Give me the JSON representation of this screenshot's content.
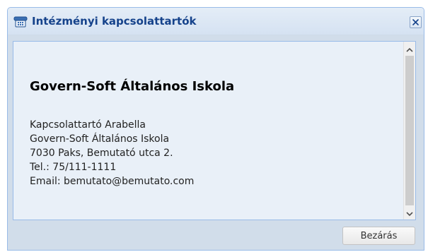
{
  "dialog": {
    "title": "Intézményi kapcsolattartók",
    "title_icon": "telephone-icon",
    "close_icon": "close-icon"
  },
  "contact": {
    "organization": "Govern-Soft Általános Iskola",
    "lines": [
      "Kapcsolattartó Arabella",
      "Govern-Soft Általános Iskola",
      "7030 Paks, Bemutató utca 2.",
      "Tel.: 75/111-1111",
      "Email: bemutato@bemutato.com"
    ]
  },
  "footer": {
    "close_label": "Bezárás"
  },
  "colors": {
    "title_text": "#15428b",
    "border": "#99bbe8",
    "dialog_bg": "#d1ddea",
    "content_bg": "#e9f0f8"
  }
}
